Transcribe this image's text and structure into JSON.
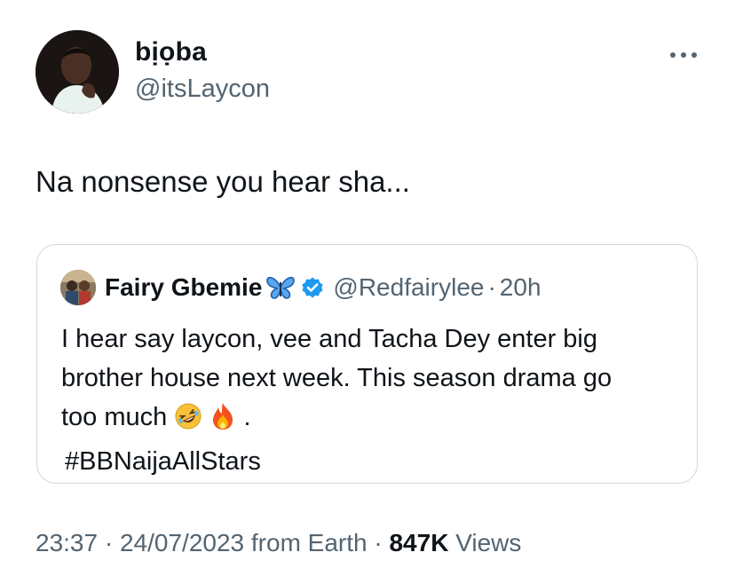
{
  "author": {
    "name": "bịọba",
    "handle": "@itsLaycon"
  },
  "tweet": {
    "text": "Na nonsense you hear sha..."
  },
  "quoted": {
    "name": "Fairy Gbemie",
    "handle": "@Redfairylee",
    "separator": "·",
    "time": "20h",
    "line1": "I hear say laycon, vee and Tacha Dey enter big",
    "line2": "brother house next week. This season drama go",
    "line3_text": "too much",
    "line3_end": ".",
    "hashtag": "#BBNaijaAllStars",
    "icons": [
      "butterfly-icon",
      "verified-badge-icon",
      "rofl-emoji-icon",
      "fire-emoji-icon"
    ]
  },
  "meta": {
    "time": "23:37",
    "sep1": "·",
    "date": "24/07/2023",
    "source": "from Earth",
    "sep2": "·",
    "views_count": "847K",
    "views_label": "Views"
  },
  "colors": {
    "text": "#0f1419",
    "secondary": "#536471",
    "border": "#cfd9de",
    "verified": "#1d9bf0",
    "butterfly": "#3b8de0"
  }
}
